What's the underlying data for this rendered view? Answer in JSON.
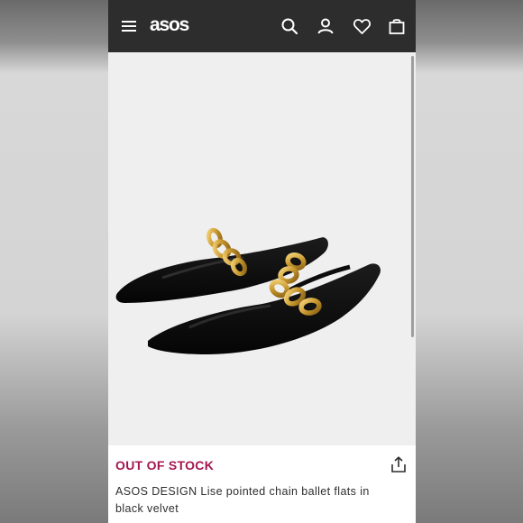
{
  "header": {
    "logo": "asos",
    "icons": [
      "menu-icon",
      "search-icon",
      "account-icon",
      "heart-icon",
      "bag-icon"
    ]
  },
  "gallery": {
    "image_count": 4,
    "active_index": 0
  },
  "product": {
    "stock_status": "OUT OF STOCK",
    "title": "ASOS DESIGN Lise pointed chain ballet flats in black velvet"
  },
  "colors": {
    "header_bg": "#2d2d2d",
    "stock_color": "#a4164f",
    "background": "#efefef"
  }
}
